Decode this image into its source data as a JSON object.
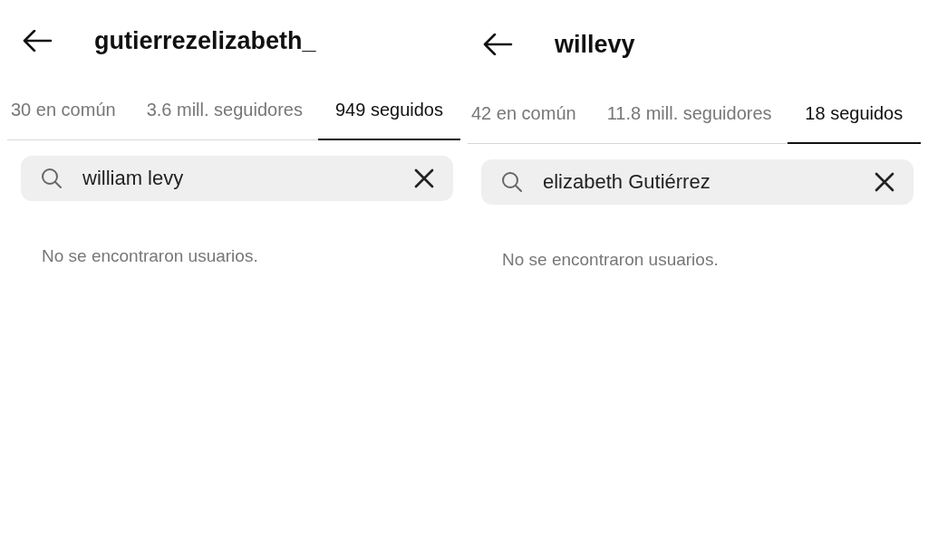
{
  "panels": [
    {
      "title": "gutierrezelizabeth_",
      "tabs": [
        {
          "label": "30 en común",
          "selected": false
        },
        {
          "label": "3.6 mill. seguidores",
          "selected": false
        },
        {
          "label": "949 seguidos",
          "selected": true
        }
      ],
      "search": {
        "value": "william levy"
      },
      "message": "No se encontraron usuarios."
    },
    {
      "title": "willevy",
      "tabs": [
        {
          "label": "42 en común",
          "selected": false
        },
        {
          "label": "11.8 mill. seguidores",
          "selected": false
        },
        {
          "label": "18 seguidos",
          "selected": true
        }
      ],
      "search": {
        "value": "elizabeth Gutiérrez"
      },
      "message": "No se encontraron usuarios."
    }
  ]
}
